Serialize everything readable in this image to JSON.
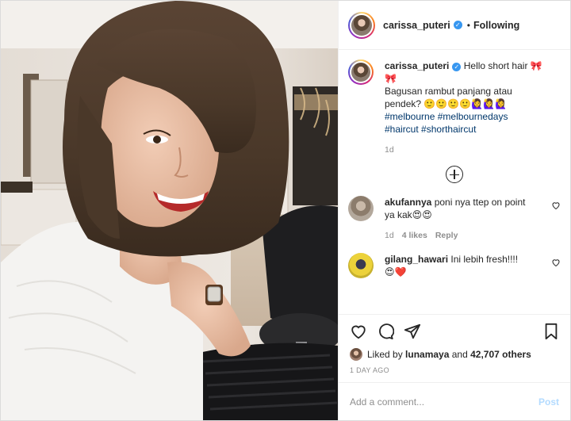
{
  "post": {
    "username": "carissa_puteri",
    "follow_status": "Following",
    "separator": "•"
  },
  "caption": {
    "username": "carissa_puteri",
    "text_line1": "Hello short hair 🎀",
    "text_line1b": "🎀",
    "text_line2": "Bagusan rambut panjang atau",
    "text_line3": "pendek? 🙂🙂🙂🙂🙋‍♀️🙋‍♀️🙋‍♀️",
    "hashtags": [
      "#melbourne",
      "#melbournedays",
      "#haircut",
      "#shorthaircut"
    ],
    "time": "1d"
  },
  "comments": [
    {
      "username": "akufannya",
      "text_a": "poni nya ttep on point",
      "text_b": "ya kak😍😍",
      "time": "1d",
      "likes": "4 likes",
      "reply": "Reply"
    },
    {
      "username": "gilang_hawari",
      "text_a": "Ini lebih fresh!!!!",
      "text_b": "😍❤️"
    }
  ],
  "likes": {
    "prefix": "Liked by",
    "user": "lunamaya",
    "and": "and",
    "others": "42,707 others"
  },
  "timestamp": "1 DAY AGO",
  "add_comment": {
    "placeholder": "Add a comment...",
    "post_label": "Post"
  },
  "icons": {
    "verified": "verified-badge-icon",
    "like": "heart-icon",
    "comment": "comment-bubble-icon",
    "share": "paper-plane-icon",
    "save": "bookmark-icon",
    "load_more": "plus-circle-icon"
  },
  "colors": {
    "verified_blue": "#3897f0",
    "hashtag": "#00376b",
    "post_button_disabled": "#b3dbff",
    "muted_text": "#8e8e8e"
  }
}
